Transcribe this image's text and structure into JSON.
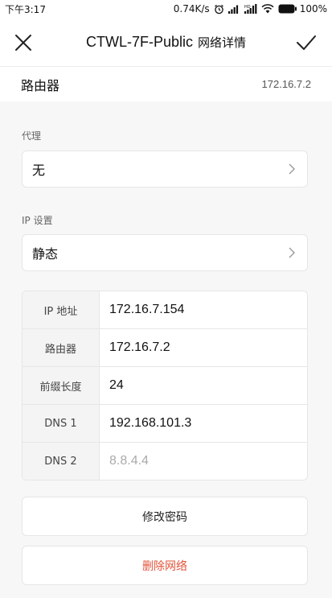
{
  "status_bar": {
    "time": "下午3:17",
    "net_speed": "0.74K/s",
    "battery": "100%",
    "icons": [
      "alarm-icon",
      "signal-icon",
      "hd-signal-icon",
      "wifi-icon",
      "battery-icon"
    ]
  },
  "title_bar": {
    "ssid": "CTWL-7F-Public",
    "suffix": "网络详情",
    "close_icon": "close-icon",
    "confirm_icon": "check-icon"
  },
  "router": {
    "label": "路由器",
    "value": "172.16.7.2"
  },
  "proxy": {
    "label": "代理",
    "value": "无"
  },
  "ip_settings": {
    "label": "IP 设置",
    "value": "静态"
  },
  "ip_table": {
    "rows": [
      {
        "key": "IP 地址",
        "value": "172.16.7.154"
      },
      {
        "key": "路由器",
        "value": "172.16.7.2"
      },
      {
        "key": "前缀长度",
        "value": "24"
      },
      {
        "key": "DNS 1",
        "value": "192.168.101.3"
      },
      {
        "key": "DNS 2",
        "placeholder": "8.8.4.4"
      }
    ]
  },
  "actions": {
    "modify_password": "修改密码",
    "delete_network": "删除网络"
  },
  "colors": {
    "danger": "#e2553b",
    "background": "#f7f7f7"
  }
}
